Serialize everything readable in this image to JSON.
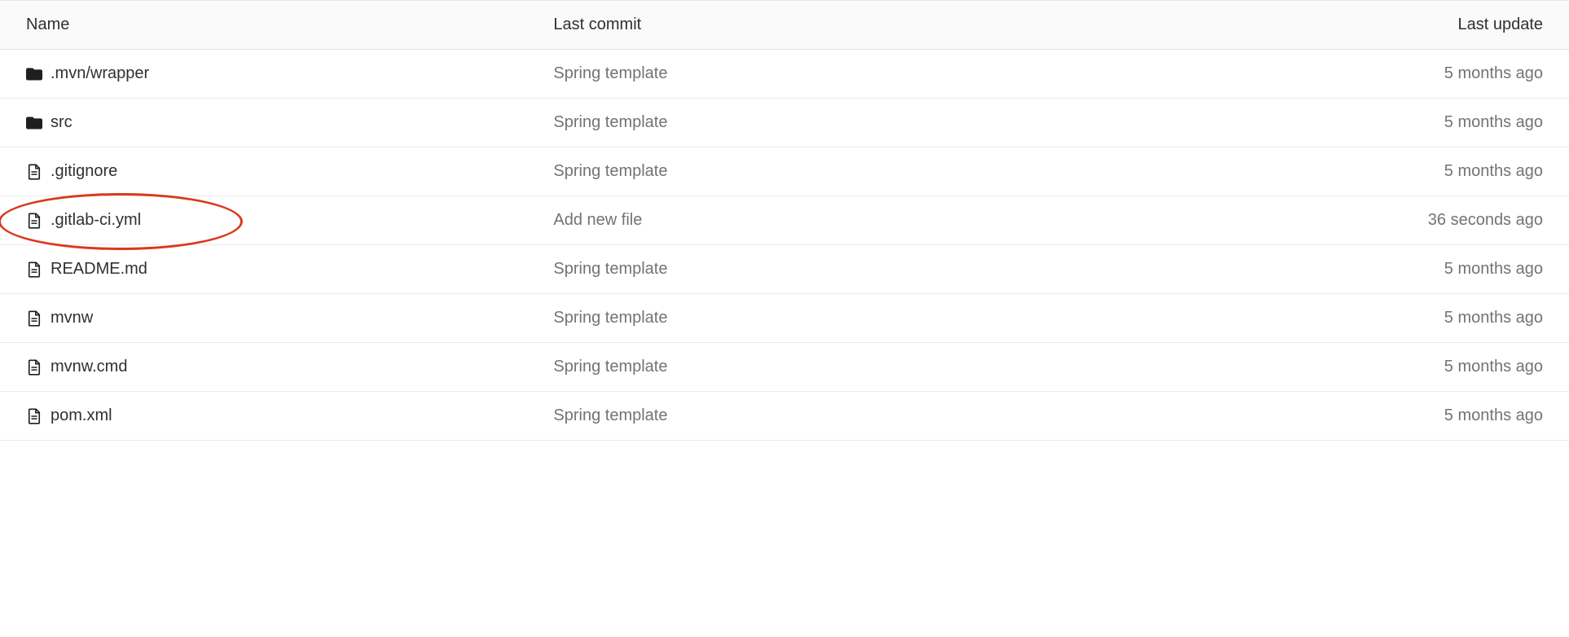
{
  "table": {
    "headers": {
      "name": "Name",
      "last_commit": "Last commit",
      "last_update": "Last update"
    },
    "rows": [
      {
        "type": "folder",
        "name": ".mvn/wrapper",
        "commit": "Spring template",
        "update": "5 months ago",
        "highlight": false
      },
      {
        "type": "folder",
        "name": "src",
        "commit": "Spring template",
        "update": "5 months ago",
        "highlight": false
      },
      {
        "type": "file",
        "name": ".gitignore",
        "commit": "Spring template",
        "update": "5 months ago",
        "highlight": false
      },
      {
        "type": "file",
        "name": ".gitlab-ci.yml",
        "commit": "Add new file",
        "update": "36 seconds ago",
        "highlight": true
      },
      {
        "type": "file",
        "name": "README.md",
        "commit": "Spring template",
        "update": "5 months ago",
        "highlight": false
      },
      {
        "type": "file",
        "name": "mvnw",
        "commit": "Spring template",
        "update": "5 months ago",
        "highlight": false
      },
      {
        "type": "file",
        "name": "mvnw.cmd",
        "commit": "Spring template",
        "update": "5 months ago",
        "highlight": false
      },
      {
        "type": "file",
        "name": "pom.xml",
        "commit": "Spring template",
        "update": "5 months ago",
        "highlight": false
      }
    ]
  }
}
